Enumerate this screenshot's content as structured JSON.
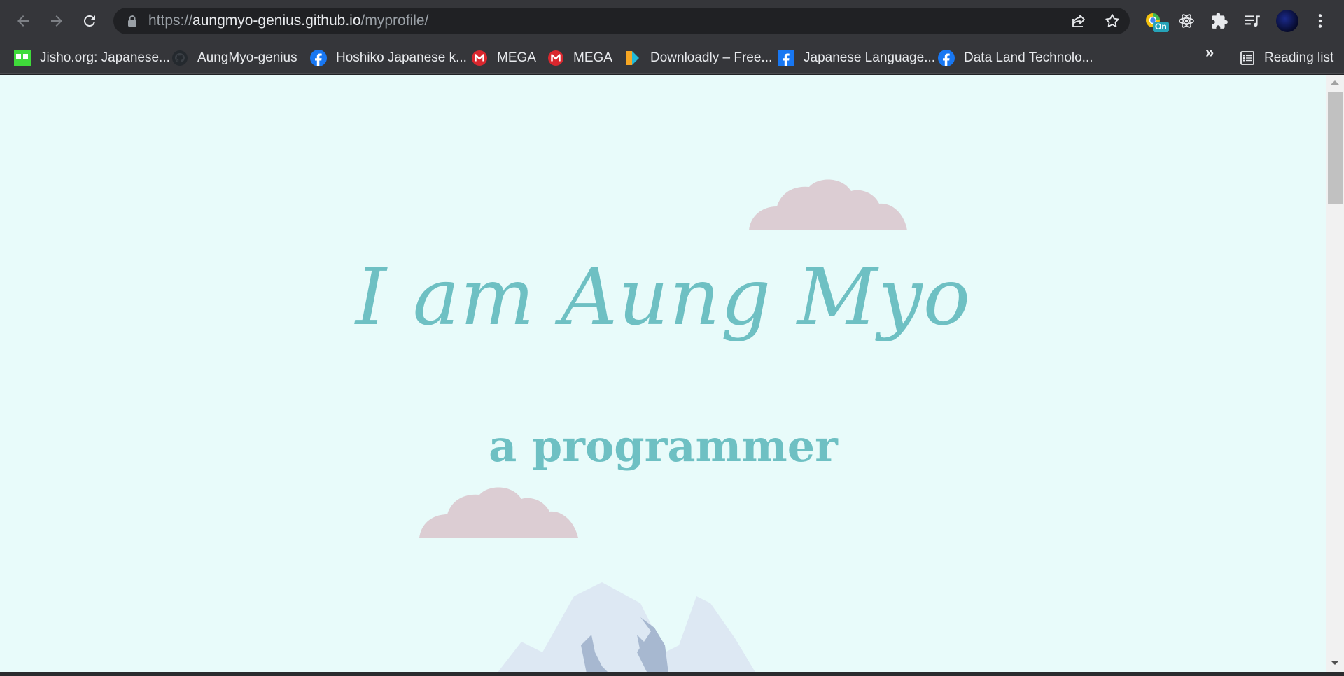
{
  "browser": {
    "url_scheme": "https://",
    "url_host": "aungmyo-genius.github.io",
    "url_path": "/myprofile/",
    "extension_badge": "On",
    "bookmarks": [
      {
        "label": "Jisho.org: Japanese...",
        "icon": "jisho-icon"
      },
      {
        "label": "AungMyo-genius",
        "icon": "github-icon"
      },
      {
        "label": "Hoshiko Japanese k...",
        "icon": "facebook-icon"
      },
      {
        "label": "MEGA",
        "icon": "mega-icon"
      },
      {
        "label": "MEGA",
        "icon": "mega-icon"
      },
      {
        "label": "Downloadly – Free...",
        "icon": "downloadly-icon"
      },
      {
        "label": "Japanese Language...",
        "icon": "facebook-icon"
      },
      {
        "label": "Data Land Technolo...",
        "icon": "facebook-icon"
      }
    ],
    "more_bookmarks": "»",
    "reading_list": "Reading list"
  },
  "page": {
    "headline": "I am Aung Myo",
    "subheadline": "a programmer",
    "colors": {
      "background": "#e8fbfa",
      "text_accent": "#6ec0c3",
      "cloud": "#dccdd3",
      "mountain": "#dde8f3"
    }
  }
}
